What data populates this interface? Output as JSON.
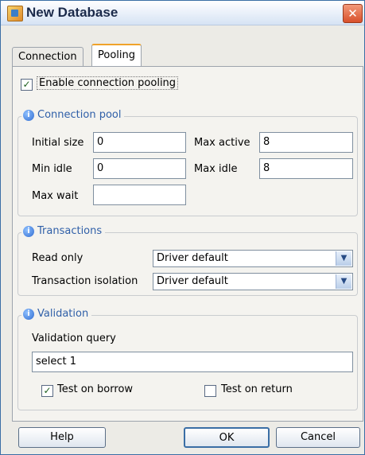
{
  "window": {
    "title": "New Database",
    "close_symbol": "✕"
  },
  "tabs": [
    {
      "label": "Connection"
    },
    {
      "label": "Pooling",
      "active": true
    }
  ],
  "enable_pooling": {
    "label": "Enable connection pooling",
    "checked": true
  },
  "connection_pool": {
    "title": "Connection pool",
    "initial_size": {
      "label": "Initial size",
      "value": "0"
    },
    "max_active": {
      "label": "Max active",
      "value": "8"
    },
    "min_idle": {
      "label": "Min idle",
      "value": "0"
    },
    "max_idle": {
      "label": "Max idle",
      "value": "8"
    },
    "max_wait": {
      "label": "Max wait",
      "value": ""
    }
  },
  "transactions": {
    "title": "Transactions",
    "read_only": {
      "label": "Read only",
      "selected": "Driver default"
    },
    "isolation": {
      "label": "Transaction isolation",
      "selected": "Driver default"
    }
  },
  "validation": {
    "title": "Validation",
    "query_label": "Validation query",
    "query_value": "select 1",
    "test_on_borrow": {
      "label": "Test on borrow",
      "checked": true
    },
    "test_on_return": {
      "label": "Test on return",
      "checked": false
    }
  },
  "buttons": {
    "help": "Help",
    "ok": "OK",
    "cancel": "Cancel"
  },
  "icons": {
    "check_mark": "✓",
    "dropdown_arrow": "▼",
    "info_letter": "i"
  },
  "colors": {
    "title_accent": "#1b2a4a",
    "group_title": "#2f5fa8",
    "active_tab_accent": "#f0a22a"
  }
}
